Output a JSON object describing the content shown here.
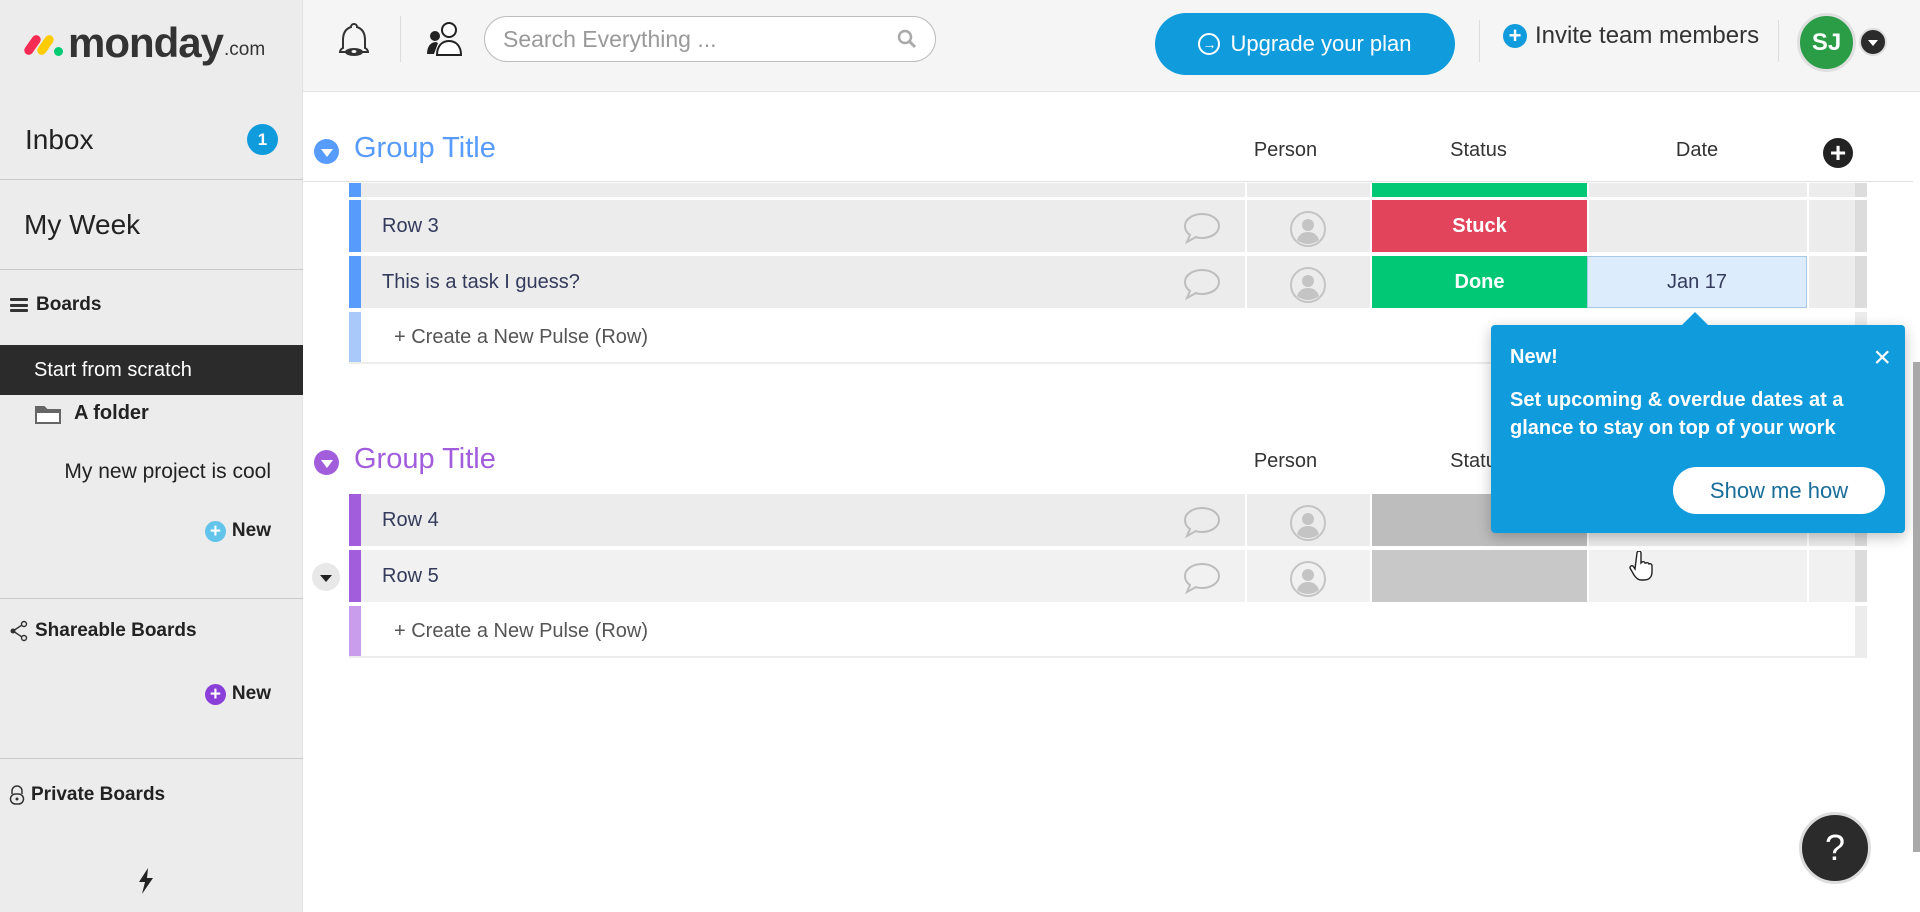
{
  "brand": {
    "name": "monday",
    "suffix": ".com"
  },
  "sidebar": {
    "inbox": {
      "label": "Inbox",
      "badge": "1"
    },
    "my_week": {
      "label": "My Week"
    },
    "boards": {
      "label": "Boards"
    },
    "active_board": "Start from scratch",
    "folder": {
      "label": "A folder"
    },
    "folder_item": "My new project is cool",
    "new_label_1": "New",
    "shareable": {
      "label": "Shareable Boards"
    },
    "new_label_2": "New",
    "private": {
      "label": "Private Boards"
    }
  },
  "topbar": {
    "search_placeholder": "Search Everything ...",
    "upgrade_label": "Upgrade your plan",
    "invite_label": "Invite team members",
    "avatar_initials": "SJ"
  },
  "columns": {
    "person": "Person",
    "status": "Status",
    "date": "Date"
  },
  "colors": {
    "group1": "#579bfc",
    "group2": "#a25ddc",
    "done": "#00c875",
    "stuck": "#e2445c",
    "empty_status": "#c4c4c4",
    "accent": "#109bdc"
  },
  "groups": [
    {
      "title": "Group Title",
      "rows": [
        {
          "name": "Row 3",
          "status": "Stuck",
          "date": ""
        },
        {
          "name": "This is a task I guess?",
          "status": "Done",
          "date": "Jan 17"
        }
      ],
      "create_label": "+ Create a New Pulse (Row)"
    },
    {
      "title": "Group Title",
      "rows": [
        {
          "name": "Row 4",
          "status": "",
          "date": ""
        },
        {
          "name": "Row 5",
          "status": "",
          "date": ""
        }
      ],
      "create_label": "+ Create a New Pulse (Row)"
    }
  ],
  "tooltip": {
    "title": "New!",
    "body": "Set upcoming & overdue dates at a glance to stay on top of your work",
    "button": "Show me how"
  },
  "help_label": "?"
}
